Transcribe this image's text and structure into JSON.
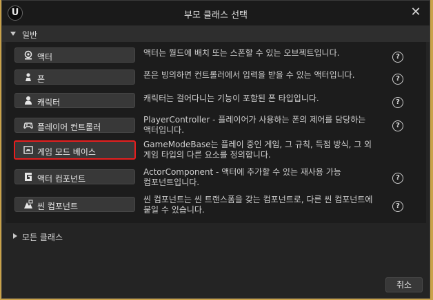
{
  "dialog": {
    "title": "부모 클래스 선택",
    "logo": "U"
  },
  "section": {
    "label": "일반"
  },
  "classes": [
    {
      "label": "액터",
      "icon": "actor-icon",
      "desc1": "액터는 월드에 배치 또는 스폰할 수 있는 오브젝트입니다.",
      "desc2": ""
    },
    {
      "label": "폰",
      "icon": "pawn-icon",
      "desc1": "폰은 빙의하면 컨트롤러에서 입력을 받을 수 있는 액터입니다.",
      "desc2": ""
    },
    {
      "label": "캐릭터",
      "icon": "character-icon",
      "desc1": "캐릭터는 걸어다니는 기능이 포함된 폰 타입입니다.",
      "desc2": ""
    },
    {
      "label": "플레이어 컨트롤러",
      "icon": "gamepad-icon",
      "desc1": "PlayerController - 플레이어가 사용하는 폰의 제어를 담당하는",
      "desc2": "액터입니다."
    },
    {
      "label": "게임 모드 베이스",
      "icon": "game-mode-icon",
      "desc1": "GameModeBase는 플레이 중인 게임, 그 규칙, 득점 방식, 그 외",
      "desc2": "게임 타입의 다른 요소를 정의합니다."
    },
    {
      "label": "액터 컴포넌트",
      "icon": "actor-component-icon",
      "desc1": "ActorComponent - 액터에 추가할 수 있는 재사용 가능",
      "desc2": "컴포넌트입니다."
    },
    {
      "label": "씬 컴포넌트",
      "icon": "scene-component-icon",
      "desc1": "씬 컴포넌트는 씬 트랜스폼을 갖는 컴포넌트로, 다른 씬 컴포넌트에",
      "desc2": "붙일 수 있습니다."
    }
  ],
  "help_glyph": "?",
  "all_classes": {
    "label": "모든 클래스"
  },
  "cancel_label": "취소",
  "close_glyph": "✕"
}
